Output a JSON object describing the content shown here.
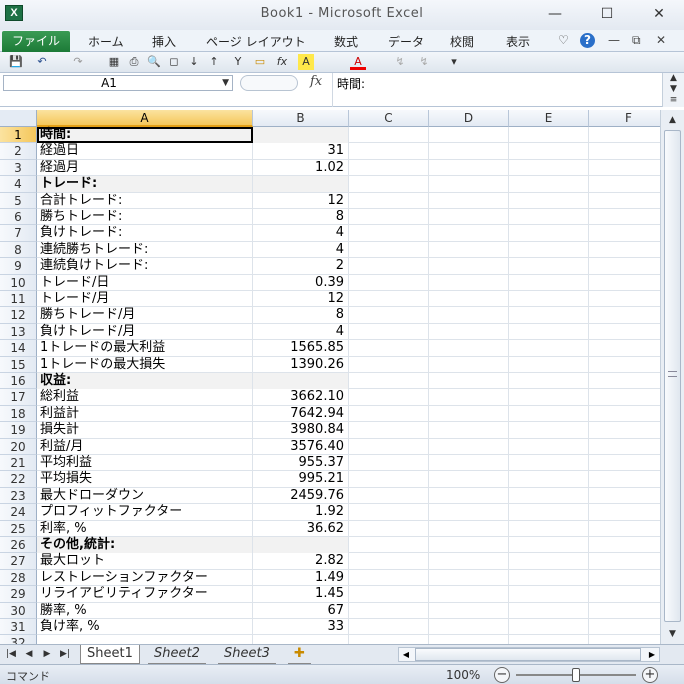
{
  "window": {
    "title": "Book1 - Microsoft Excel",
    "app_icon_letter": "X",
    "minimize": "—",
    "maximize": "☐",
    "close": "✕"
  },
  "ribbon": {
    "file_tab": "ファイル",
    "tabs": [
      "ホーム",
      "挿入",
      "ページ レイアウト",
      "数式",
      "データ",
      "校閲",
      "表示"
    ],
    "help_icon": "?",
    "extra_icons": [
      "♡",
      "—",
      "⧉",
      "✕"
    ]
  },
  "quick_access": {
    "icons": [
      "💾",
      "↶",
      "↷",
      "▦",
      "⎙",
      "🔍",
      "◻",
      "↓",
      "↑",
      "Y",
      "▭",
      "fx",
      "A",
      "A",
      "↯",
      "↯",
      "▾"
    ]
  },
  "formula_bar": {
    "name_box": "A1",
    "fx": "fx",
    "content": "時間:"
  },
  "columns": [
    "A",
    "B",
    "C",
    "D",
    "E",
    "F"
  ],
  "rows": [
    {
      "num": "1",
      "a": "時間:",
      "b": "",
      "section": true
    },
    {
      "num": "2",
      "a": "経過日",
      "b": "31",
      "section": false
    },
    {
      "num": "3",
      "a": "経過月",
      "b": "1.02",
      "section": false
    },
    {
      "num": "4",
      "a": "トレード:",
      "b": "",
      "section": true
    },
    {
      "num": "5",
      "a": "合計トレード:",
      "b": "12",
      "section": false
    },
    {
      "num": "6",
      "a": "勝ちトレード:",
      "b": "8",
      "section": false
    },
    {
      "num": "7",
      "a": "負けトレード:",
      "b": "4",
      "section": false
    },
    {
      "num": "8",
      "a": "連続勝ちトレード:",
      "b": "4",
      "section": false
    },
    {
      "num": "9",
      "a": "連続負けトレード:",
      "b": "2",
      "section": false
    },
    {
      "num": "10",
      "a": "トレード/日",
      "b": "0.39",
      "section": false
    },
    {
      "num": "11",
      "a": "トレード/月",
      "b": "12",
      "section": false
    },
    {
      "num": "12",
      "a": "勝ちトレード/月",
      "b": "8",
      "section": false
    },
    {
      "num": "13",
      "a": "負けトレード/月",
      "b": "4",
      "section": false
    },
    {
      "num": "14",
      "a": "1トレードの最大利益",
      "b": "1565.85",
      "section": false
    },
    {
      "num": "15",
      "a": "1トレードの最大損失",
      "b": "1390.26",
      "section": false
    },
    {
      "num": "16",
      "a": "収益:",
      "b": "",
      "section": true
    },
    {
      "num": "17",
      "a": "総利益",
      "b": "3662.10",
      "section": false
    },
    {
      "num": "18",
      "a": "利益計",
      "b": "7642.94",
      "section": false
    },
    {
      "num": "19",
      "a": "損失計",
      "b": "3980.84",
      "section": false
    },
    {
      "num": "20",
      "a": "利益/月",
      "b": "3576.40",
      "section": false
    },
    {
      "num": "21",
      "a": "平均利益",
      "b": "955.37",
      "section": false
    },
    {
      "num": "22",
      "a": "平均損失",
      "b": "995.21",
      "section": false
    },
    {
      "num": "23",
      "a": "最大ドローダウン",
      "b": "2459.76",
      "section": false
    },
    {
      "num": "24",
      "a": "プロフィットファクター",
      "b": "1.92",
      "section": false
    },
    {
      "num": "25",
      "a": "利率, %",
      "b": "36.62",
      "section": false
    },
    {
      "num": "26",
      "a": "その他,統計:",
      "b": "",
      "section": true
    },
    {
      "num": "27",
      "a": "最大ロット",
      "b": "2.82",
      "section": false
    },
    {
      "num": "28",
      "a": "レストレーションファクター",
      "b": "1.49",
      "section": false
    },
    {
      "num": "29",
      "a": "リライアビリティファクター",
      "b": "1.45",
      "section": false
    },
    {
      "num": "30",
      "a": "勝率, %",
      "b": "67",
      "section": false
    },
    {
      "num": "31",
      "a": "負け率, %",
      "b": "33",
      "section": false
    },
    {
      "num": "32",
      "a": "",
      "b": "",
      "section": false
    }
  ],
  "sheets": {
    "tabs": [
      "Sheet1",
      "Sheet2",
      "Sheet3"
    ],
    "active": "Sheet1"
  },
  "status": {
    "mode": "コマンド",
    "zoom": "100%",
    "zoom_level_fraction": 0.5
  },
  "colors": {
    "file_tab": "#1c7a37",
    "active_header": "#f5c75b",
    "section_fill": "#f2f2f2"
  }
}
